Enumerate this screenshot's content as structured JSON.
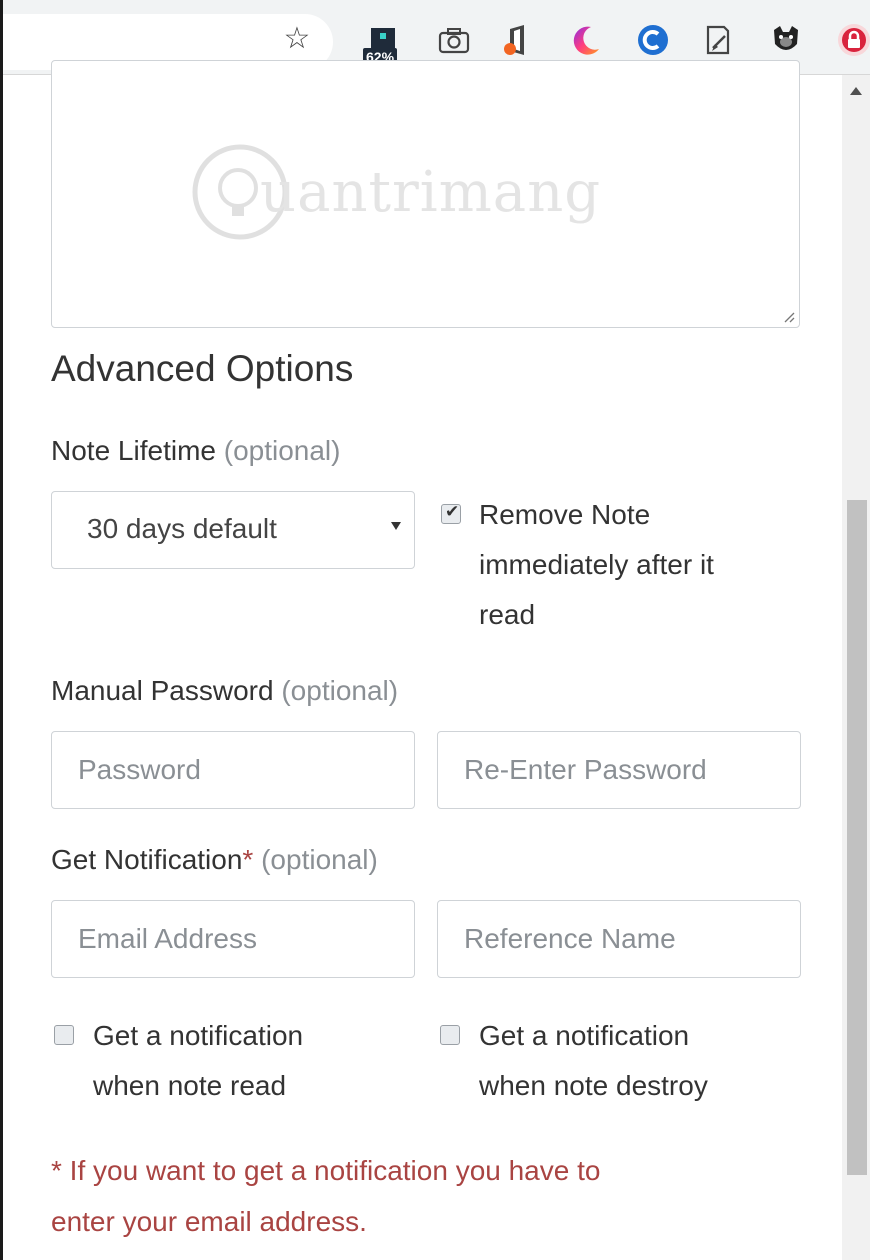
{
  "toolbar": {
    "extension_badge": "62%"
  },
  "form": {
    "heading": "Advanced Options",
    "lifetime": {
      "label": "Note Lifetime",
      "optional": "(optional)",
      "selected": "30 days default"
    },
    "remove_after_read": {
      "checked": true,
      "line1": "Remove Note",
      "line2": "immediately after it",
      "line3": "read"
    },
    "password": {
      "label": "Manual Password",
      "optional": "(optional)",
      "placeholder": "Password",
      "reenter_placeholder": "Re-Enter Password"
    },
    "notification": {
      "label": "Get Notification",
      "required_mark": "*",
      "optional": "(optional)",
      "email_placeholder": "Email Address",
      "reference_placeholder": "Reference Name",
      "notify_read_line1": "Get a notification",
      "notify_read_line2": "when note read",
      "notify_destroy_line1": "Get a notification",
      "notify_destroy_line2": "when note destroy"
    },
    "warning_line1": "* If you want to get a notification you have to",
    "warning_line2": "enter your email address."
  },
  "watermark": {
    "text": "uantrimang"
  },
  "colors": {
    "warning": "#a94442",
    "muted": "#8a8f94"
  }
}
